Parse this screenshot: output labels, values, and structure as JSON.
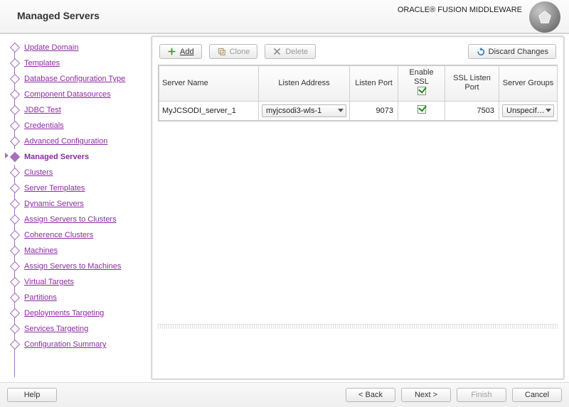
{
  "header": {
    "title": "Managed Servers",
    "brand_main": "ORACLE",
    "brand_reg": "®",
    "brand_sub": "FUSION MIDDLEWARE"
  },
  "sidebar": {
    "items": [
      {
        "label": "Update Domain"
      },
      {
        "label": "Templates"
      },
      {
        "label": "Database Configuration Type"
      },
      {
        "label": "Component Datasources"
      },
      {
        "label": "JDBC Test"
      },
      {
        "label": "Credentials"
      },
      {
        "label": "Advanced Configuration"
      },
      {
        "label": "Managed Servers",
        "active": true
      },
      {
        "label": "Clusters"
      },
      {
        "label": "Server Templates"
      },
      {
        "label": "Dynamic Servers"
      },
      {
        "label": "Assign Servers to Clusters"
      },
      {
        "label": "Coherence Clusters"
      },
      {
        "label": "Machines"
      },
      {
        "label": "Assign Servers to Machines"
      },
      {
        "label": "Virtual Targets"
      },
      {
        "label": "Partitions"
      },
      {
        "label": "Deployments Targeting"
      },
      {
        "label": "Services Targeting"
      },
      {
        "label": "Configuration Summary"
      }
    ]
  },
  "toolbar": {
    "add": "Add",
    "clone": "Clone",
    "delete": "Delete",
    "discard": "Discard Changes"
  },
  "table": {
    "columns": {
      "server_name": "Server Name",
      "listen_address": "Listen Address",
      "listen_port": "Listen Port",
      "enable_ssl": "Enable SSL",
      "ssl_listen_port": "SSL Listen Port",
      "server_groups": "Server Groups"
    },
    "rows": [
      {
        "server_name": "MyJCSODI_server_1",
        "listen_address": "myjcsodi3-wls-1",
        "listen_port": "9073",
        "enable_ssl": true,
        "ssl_listen_port": "7503",
        "server_groups": "Unspecified"
      }
    ]
  },
  "footer": {
    "help": "Help",
    "back": "< Back",
    "next": "Next >",
    "finish": "Finish",
    "cancel": "Cancel"
  }
}
